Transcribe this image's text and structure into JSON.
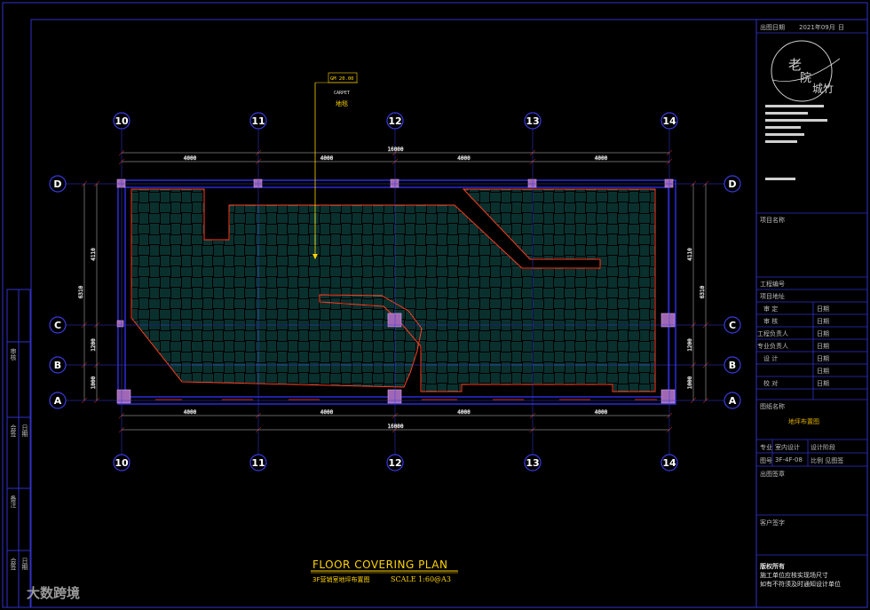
{
  "title_block": {
    "date_label": "出图日期",
    "date_value": "2021年09月",
    "date_suffix": "日",
    "project_name_label": "项目名称",
    "project_no_label": "工程编号",
    "project_location_label": "项目地址",
    "rows": [
      {
        "label": "审    定",
        "sign": "日期"
      },
      {
        "label": "审    核",
        "sign": "日期"
      },
      {
        "label": "工程负责人",
        "sign": "日期"
      },
      {
        "label": "专业负责人",
        "sign": "日期"
      },
      {
        "label": "设    计",
        "sign": "日期"
      },
      {
        "label": "",
        "sign": "日期"
      },
      {
        "label": "校    对",
        "sign": "日期"
      }
    ],
    "drawing_name_label": "图纸名称",
    "drawing_name": "地坪布置图",
    "discipline_label": "专业",
    "discipline": "室内设计",
    "stage": "设计阶段",
    "drawing_no_label": "图号",
    "drawing_no": "3F-4F-08",
    "scale_label": "比例 见图签",
    "issue_label": "出图签章",
    "client_label": "客户签字",
    "copyright_line1": "版权所有",
    "copyright_line2": "施工单位应核实现场尺寸",
    "copyright_line3": "如有不符须及时通知设计单位",
    "logo_text": "老院城竹"
  },
  "left_strip": [
    "审核",
    "会签",
    "日期",
    "备注",
    "会签",
    "日期"
  ],
  "plan": {
    "title": "FLOOR COVERING PLAN",
    "subtitle": "3F营销室地坪布置图",
    "scale": "SCALE 1:60@A3",
    "tag_code": "GM 20.00",
    "tag_en": "CARPET",
    "tag_cn": "地毯",
    "grid_columns": [
      "10",
      "11",
      "12",
      "13",
      "14"
    ],
    "grid_rows": [
      "D",
      "C",
      "B",
      "A"
    ],
    "dim_top_total": "16000",
    "dim_segments": [
      "4000",
      "4000",
      "4000",
      "4000"
    ],
    "dim_bottom_total": "16000",
    "dim_side_total": "6310",
    "dim_side_segments": [
      "4110",
      "1200",
      "1000"
    ]
  },
  "watermark": "大数跨境",
  "colors": {
    "border": "#3030c8",
    "wall": "#2a2ad8",
    "pattern": "#1fa29a",
    "outline": "#ff3c1e",
    "column": "#a068b4",
    "title": "#ffd400"
  }
}
